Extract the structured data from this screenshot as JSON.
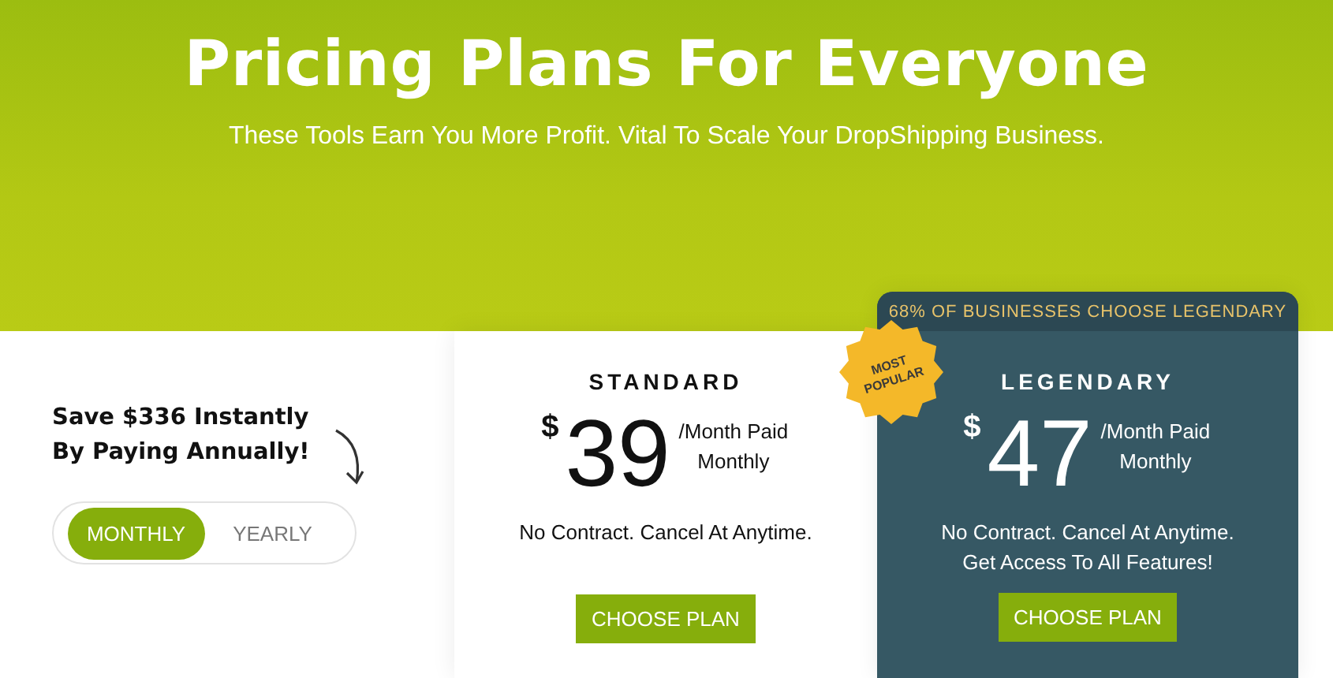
{
  "hero": {
    "title": "Pricing Plans For Everyone",
    "subtitle": "These Tools Earn You More Profit. Vital To Scale Your DropShipping Business."
  },
  "billing": {
    "headline": "Save $336 Instantly By Paying Annually!",
    "options": [
      {
        "label": "MONTHLY",
        "selected": true
      },
      {
        "label": "YEARLY",
        "selected": false
      }
    ]
  },
  "plans": [
    {
      "name": "STANDARD",
      "featured": false,
      "currency": "$",
      "price": "39",
      "period": "/Month Paid Monthly",
      "notes": [
        "No Contract. Cancel At Anytime."
      ],
      "button": "CHOOSE PLAN"
    },
    {
      "name": "LEGENDARY",
      "featured": true,
      "banner": "68% OF BUSINESSES CHOOSE LEGENDARY",
      "badge": "MOST POPULAR",
      "currency": "$",
      "price": "47",
      "period": "/Month Paid Monthly",
      "notes": [
        "No Contract. Cancel At Anytime.",
        "Get Access To All Features!"
      ],
      "button": "CHOOSE PLAN"
    }
  ]
}
